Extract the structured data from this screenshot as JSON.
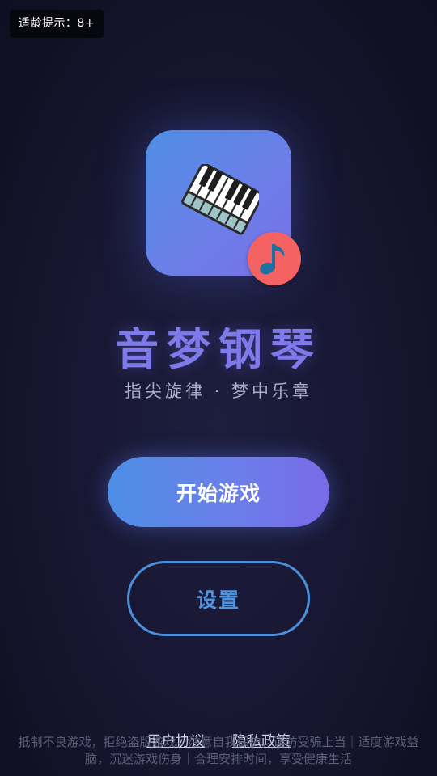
{
  "age_rating": {
    "label": "适龄提示：8+"
  },
  "app": {
    "title": "音梦钢琴",
    "subtitle": "指尖旋律 · 梦中乐章",
    "icon": "piano-icon",
    "badge_icon": "music-note-icon"
  },
  "actions": {
    "start_label": "开始游戏",
    "settings_label": "设置"
  },
  "footer": {
    "links": [
      "用户协议",
      "隐私政策"
    ],
    "health_notice": "抵制不良游戏，拒绝盗版游戏。注意自我保护，谨防受骗上当｜适度游戏益脑，沉迷游戏伤身｜合理安排时间，享受健康生活"
  },
  "colors": {
    "background": "#151530",
    "accent": "#7f7ae9",
    "primary_gradient_start": "#4d8fe6",
    "primary_gradient_end": "#7a6ae8",
    "secondary_outline": "#4b8fd8",
    "badge_red": "#f56262"
  }
}
